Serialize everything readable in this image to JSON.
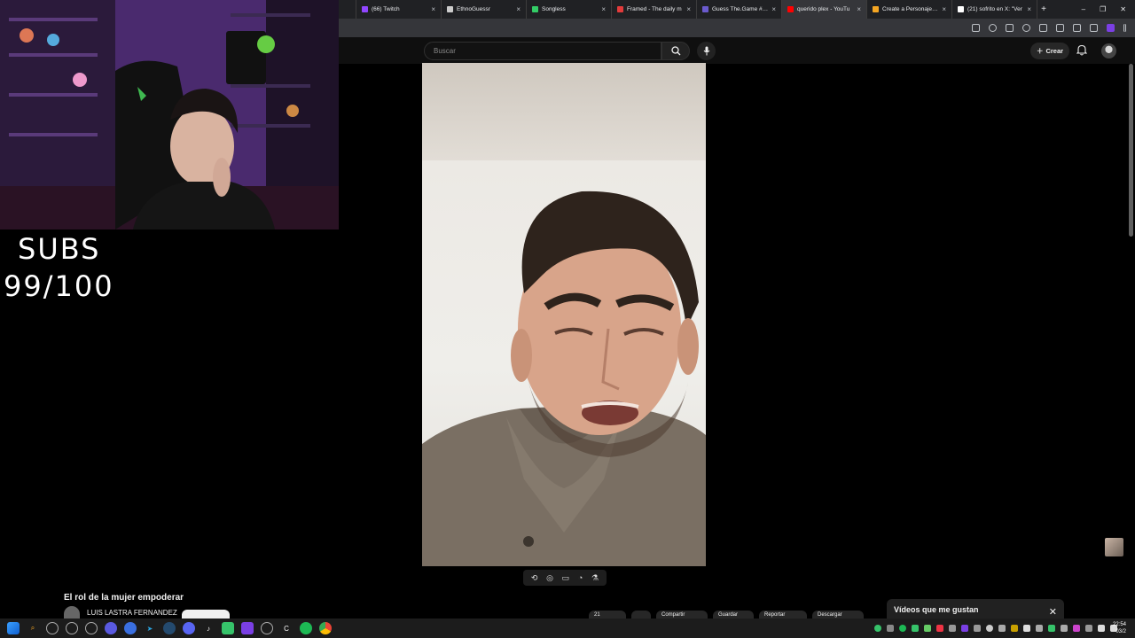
{
  "browser": {
    "tabs": [
      {
        "label": "(66) Twitch",
        "icon": "twitch-icon",
        "color": "#9146ff"
      },
      {
        "label": "EthnoGuessr",
        "icon": "globe-icon",
        "color": "#cccccc"
      },
      {
        "label": "Songless",
        "icon": "music-icon",
        "color": "#33cc66"
      },
      {
        "label": "Framed - The daily m",
        "icon": "film-icon",
        "color": "#e33b3b"
      },
      {
        "label": "Guess The.Game #13",
        "icon": "game-icon",
        "color": "#6a5acd"
      },
      {
        "label": "querido plex - YouTu",
        "icon": "youtube-icon",
        "color": "#ff0000"
      },
      {
        "label": "Create a Personajes Cl",
        "icon": "page-icon",
        "color": "#f5a623"
      },
      {
        "label": "(21) sofrito en X: \"Ver",
        "icon": "x-icon",
        "color": "#ffffff"
      }
    ],
    "new_tab": "+",
    "window_controls": [
      "–",
      "❐",
      "✕"
    ]
  },
  "youtube": {
    "search_placeholder": "Buscar",
    "create_label": "Crear",
    "video_title": "El rol de la mujer empoderar",
    "channel_name": "LUIS LASTRA FERNANDEZ",
    "liked_panel_title": "Vídeos que me gustan",
    "action_buttons": [
      "21",
      "",
      "Compartir",
      "Guardar",
      "Reportar",
      "Descargar"
    ]
  },
  "overlay": {
    "subs_label": "SUBS",
    "subs_count": "99/100"
  },
  "taskbar": {
    "time": "22:54",
    "date": "03/2"
  },
  "colors": {
    "accent_red": "#ff0000",
    "youtube_bg": "#0f0f0f",
    "tab_bg": "#202124"
  }
}
